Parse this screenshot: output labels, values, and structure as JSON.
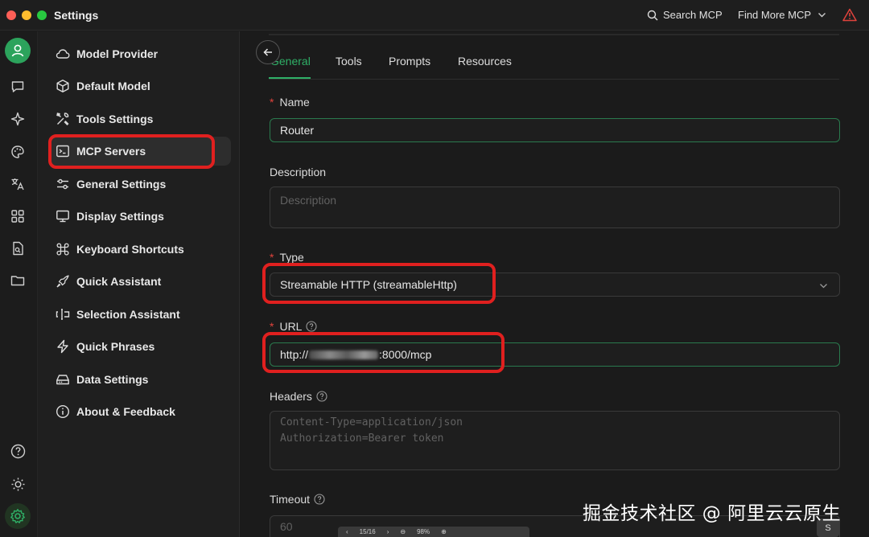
{
  "window": {
    "title": "Settings"
  },
  "header": {
    "search_label": "Search MCP",
    "find_more_label": "Find More MCP"
  },
  "menu": {
    "items": [
      {
        "label": "Model Provider",
        "icon": "cloud-icon"
      },
      {
        "label": "Default Model",
        "icon": "cube-icon"
      },
      {
        "label": "Tools Settings",
        "icon": "tools-icon"
      },
      {
        "label": "MCP Servers",
        "icon": "terminal-icon"
      },
      {
        "label": "General Settings",
        "icon": "sliders-icon"
      },
      {
        "label": "Display Settings",
        "icon": "monitor-icon"
      },
      {
        "label": "Keyboard Shortcuts",
        "icon": "command-icon"
      },
      {
        "label": "Quick Assistant",
        "icon": "rocket-icon"
      },
      {
        "label": "Selection Assistant",
        "icon": "text-select-icon"
      },
      {
        "label": "Quick Phrases",
        "icon": "zap-icon"
      },
      {
        "label": "Data Settings",
        "icon": "hard-drive-icon"
      },
      {
        "label": "About & Feedback",
        "icon": "info-icon"
      }
    ],
    "active": "MCP Servers"
  },
  "tabs": [
    "General",
    "Tools",
    "Prompts",
    "Resources"
  ],
  "form": {
    "required_mark": "*",
    "name": {
      "label": "Name",
      "value": "Router"
    },
    "description": {
      "label": "Description",
      "placeholder": "Description"
    },
    "type": {
      "label": "Type",
      "value": "Streamable HTTP (streamableHttp)"
    },
    "url": {
      "label": "URL",
      "value_prefix": "http://",
      "value_suffix": ":8000/mcp"
    },
    "headers": {
      "label": "Headers",
      "placeholder_line1": "Content-Type=application/json",
      "placeholder_line2": "Authorization=Bearer token"
    },
    "timeout": {
      "label": "Timeout",
      "placeholder": "60"
    }
  },
  "overlay": {
    "watermark": "掘金技术社区 @ 阿里云云原生",
    "viewer_page": "15/16",
    "viewer_zoom": "98%",
    "corner_badge": "S"
  },
  "colors": {
    "accent": "#2fb067",
    "highlight": "#e0201f",
    "required": "#e0433c"
  }
}
